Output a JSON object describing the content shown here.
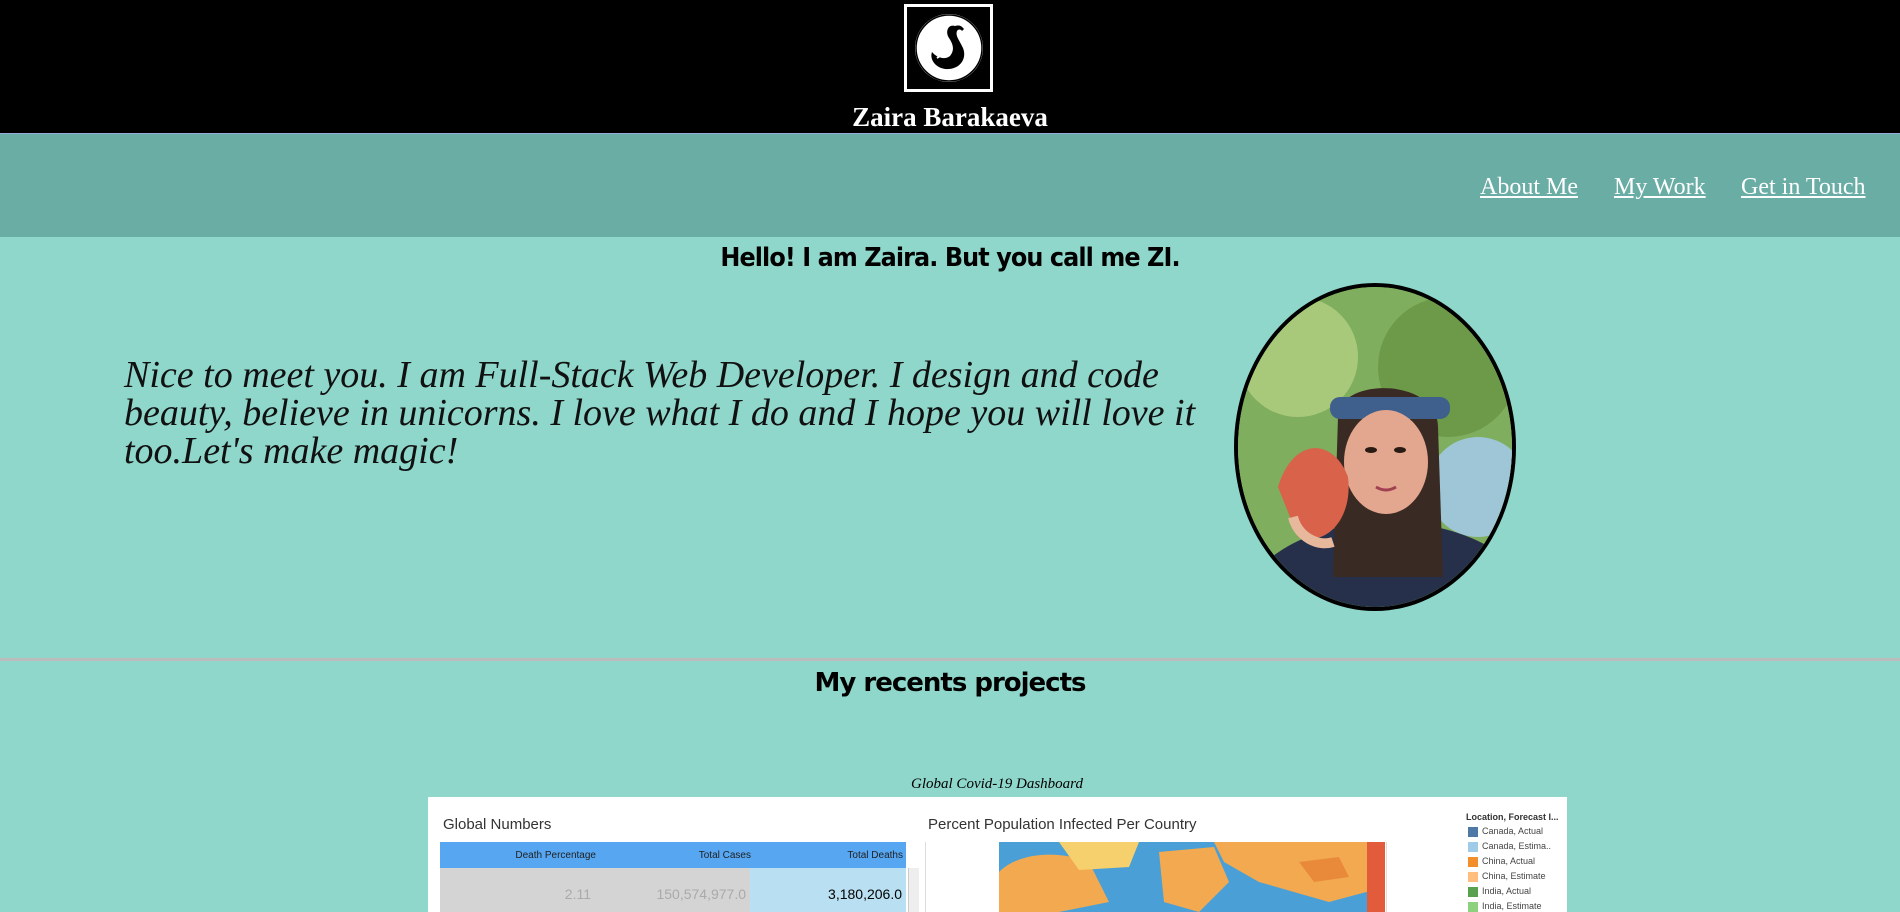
{
  "header": {
    "site_name": "Zaira Barakaeva",
    "logo_icon": "swan-icon"
  },
  "nav": {
    "items": [
      {
        "label": "About Me"
      },
      {
        "label": "My Work"
      },
      {
        "label": "Get in Touch"
      }
    ]
  },
  "hero": {
    "greeting": "Hello! I am Zaira. But you call me ZI.",
    "intro": "Nice to meet you. I am Full-Stack Web Developer. I design and code beauty, believe in unicorns. I love what I do and I hope you will love it too.Let's make magic!"
  },
  "projects": {
    "heading": "My recents projects",
    "items": [
      {
        "caption": "Global Covid-19 Dashboard",
        "panel_left_title": "Global Numbers",
        "panel_right_title": "Percent Population Infected Per Country",
        "table": {
          "headers": [
            "Death Percentage",
            "Total Cases",
            "Total Deaths"
          ],
          "row": [
            "2.11",
            "150,574,977.0",
            "3,180,206.0"
          ]
        },
        "legend": {
          "title": "Location, Forecast I...",
          "entries": [
            {
              "label": "Canada, Actual",
              "color": "#4e79a7"
            },
            {
              "label": "Canada, Estima..",
              "color": "#a0cbe8"
            },
            {
              "label": "China, Actual",
              "color": "#f28e2b"
            },
            {
              "label": "China, Estimate",
              "color": "#ffbe7d"
            },
            {
              "label": "India, Actual",
              "color": "#59a14f"
            },
            {
              "label": "India, Estimate",
              "color": "#8cd17d"
            }
          ]
        }
      }
    ]
  },
  "colors": {
    "header_bg": "#000000",
    "nav_bg": "#69ada4",
    "page_bg": "#8fd7cb",
    "table_header": "#56a6f2"
  }
}
